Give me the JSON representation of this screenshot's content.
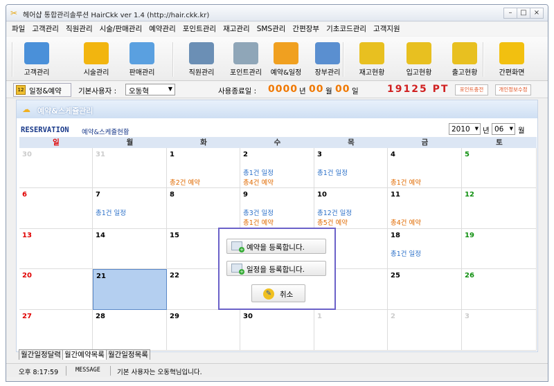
{
  "window": {
    "title": "헤어샵 통합관리솔루션 HairCkk ver 1.4 (http://hair.ckk.kr)",
    "min": "–",
    "max": "□",
    "close": "×"
  },
  "menu": [
    "파일",
    "고객관리",
    "직원관리",
    "시술/판매관리",
    "예약관리",
    "포인트관리",
    "재고관리",
    "SMS관리",
    "간편장부",
    "기초코드관리",
    "고객지원"
  ],
  "toolbar": [
    {
      "label": "고객관리",
      "icon": "customer-icon",
      "color": "#4a90d9"
    },
    {
      "label": "시술관리",
      "icon": "scissors-icon",
      "color": "#f2b50f"
    },
    {
      "label": "판매관리",
      "icon": "sales-icon",
      "color": "#5aa0e0"
    },
    {
      "label": "직원관리",
      "icon": "staff-icon",
      "color": "#6b8fb5"
    },
    {
      "label": "포인트관리",
      "icon": "calculator-icon",
      "color": "#8fa6b8"
    },
    {
      "label": "예약&일정",
      "icon": "alarm-clock-icon",
      "color": "#f0a020"
    },
    {
      "label": "장부관리",
      "icon": "ledger-icon",
      "color": "#5a8fd0"
    },
    {
      "label": "재고현황",
      "icon": "database-icon",
      "color": "#e8c020"
    },
    {
      "label": "입고현황",
      "icon": "database-in-icon",
      "color": "#e8c020"
    },
    {
      "label": "출고현황",
      "icon": "database-out-icon",
      "color": "#e8c020"
    },
    {
      "label": "간편화면",
      "icon": "windows-icon",
      "color": "#f2c010"
    }
  ],
  "info": {
    "current_view": "일정&예약",
    "user_label": "기본사용자 :",
    "user_value": "오동혁",
    "expiry_label": "사용종료일 :",
    "exp_year": "0000",
    "exp_year_unit": "년",
    "exp_month": "00",
    "exp_month_unit": "월",
    "exp_day": "00",
    "exp_day_unit": "일",
    "points": "19125 PT",
    "point_charge": "포인트충전",
    "personal_info": "개인정보수정"
  },
  "panel": {
    "title": "예약&스케쥴관리",
    "res_title": "RESERVATION",
    "res_sub": "예약&스케쥴현황",
    "year": "2010",
    "year_unit": "년",
    "month": "06",
    "month_unit": "월"
  },
  "calendar": {
    "headers": [
      "일",
      "월",
      "화",
      "수",
      "목",
      "금",
      "토"
    ],
    "weeks": [
      [
        {
          "d": "30",
          "o": true,
          "e": []
        },
        {
          "d": "31",
          "o": true,
          "e": []
        },
        {
          "d": "1",
          "e": [
            {
              "t": "총2건 예약",
              "c": "r"
            }
          ]
        },
        {
          "d": "2",
          "e": [
            {
              "t": "총1건 일정",
              "c": "s"
            },
            {
              "t": "총4건 예약",
              "c": "r"
            }
          ]
        },
        {
          "d": "3",
          "e": [
            {
              "t": "총1건 일정",
              "c": "s"
            }
          ]
        },
        {
          "d": "4",
          "e": [
            {
              "t": "총1건 예약",
              "c": "r"
            }
          ]
        },
        {
          "d": "5",
          "e": []
        }
      ],
      [
        {
          "d": "6",
          "e": []
        },
        {
          "d": "7",
          "e": [
            {
              "t": "총1건 일정",
              "c": "s"
            }
          ]
        },
        {
          "d": "8",
          "e": []
        },
        {
          "d": "9",
          "e": [
            {
              "t": "총3건 일정",
              "c": "s"
            },
            {
              "t": "총1건 예약",
              "c": "r"
            }
          ]
        },
        {
          "d": "10",
          "e": [
            {
              "t": "총12건 일정",
              "c": "s"
            },
            {
              "t": "총5건 예약",
              "c": "r"
            }
          ]
        },
        {
          "d": "11",
          "e": [
            {
              "t": "총4건 예약",
              "c": "r"
            }
          ]
        },
        {
          "d": "12",
          "e": []
        }
      ],
      [
        {
          "d": "13",
          "e": []
        },
        {
          "d": "14",
          "e": []
        },
        {
          "d": "15",
          "e": []
        },
        {
          "d": "16",
          "e": []
        },
        {
          "d": "17",
          "e": []
        },
        {
          "d": "18",
          "e": [
            {
              "t": "총1건 일정",
              "c": "s"
            }
          ]
        },
        {
          "d": "19",
          "e": []
        }
      ],
      [
        {
          "d": "20",
          "e": []
        },
        {
          "d": "21",
          "sel": true,
          "e": []
        },
        {
          "d": "22",
          "e": []
        },
        {
          "d": "23",
          "e": []
        },
        {
          "d": "24",
          "e": []
        },
        {
          "d": "25",
          "e": []
        },
        {
          "d": "26",
          "e": []
        }
      ],
      [
        {
          "d": "27",
          "e": []
        },
        {
          "d": "28",
          "e": []
        },
        {
          "d": "29",
          "e": []
        },
        {
          "d": "30",
          "e": []
        },
        {
          "d": "1",
          "o": true,
          "e": []
        },
        {
          "d": "2",
          "o": true,
          "e": []
        },
        {
          "d": "3",
          "o": true,
          "e": []
        }
      ]
    ]
  },
  "dialog": {
    "add_reservation": "예약을 등록합니다.",
    "add_schedule": "일정을 등록합니다.",
    "cancel": "취소"
  },
  "tabs": [
    "월간일정달력",
    "월간예약목록",
    "월간일정목록"
  ],
  "status": {
    "time": "오후 8:17:59",
    "type": "MESSAGE",
    "message": "기본 사용자는 오동혁님입니다."
  },
  "colors": {
    "sunday": "#e00000",
    "saturday": "#109010",
    "other": "#cccccc",
    "schedule": "#2a6fc8",
    "reservation": "#e06a00",
    "selected": "#b4cff0",
    "points": "#d02020",
    "digits": "#f07800"
  }
}
